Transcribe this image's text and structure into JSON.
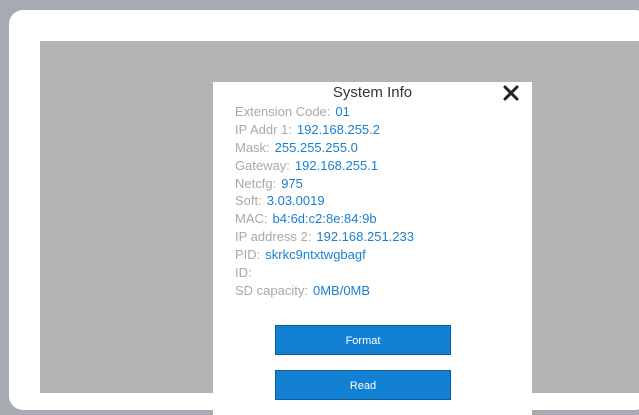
{
  "dialog": {
    "title": "System Info",
    "close_icon": "close-icon",
    "info": [
      {
        "label": "Extension Code:",
        "value": "01"
      },
      {
        "label": "IP Addr 1:",
        "value": "192.168.255.2"
      },
      {
        "label": "Mask:",
        "value": "255.255.255.0"
      },
      {
        "label": "Gateway:",
        "value": "192.168.255.1"
      },
      {
        "label": "Netcfg:",
        "value": "975"
      },
      {
        "label": "Soft:",
        "value": "3.03.0019"
      },
      {
        "label": "MAC:",
        "value": "b4:6d:c2:8e:84:9b"
      },
      {
        "label": "IP address 2:",
        "value": "192.168.251.233"
      },
      {
        "label": "PID:",
        "value": "skrkc9ntxtwgbagf"
      },
      {
        "label": "ID:",
        "value": ""
      },
      {
        "label": "SD capacity:",
        "value": "0MB/0MB"
      }
    ],
    "buttons": {
      "format": "Format",
      "read": "Read"
    }
  },
  "colors": {
    "accent": "#1381d3",
    "value_text": "#1a7fd1",
    "label_text": "#a8a8a8",
    "screen_bg": "#b3b3b1",
    "outer_bg": "#a5abb0"
  }
}
